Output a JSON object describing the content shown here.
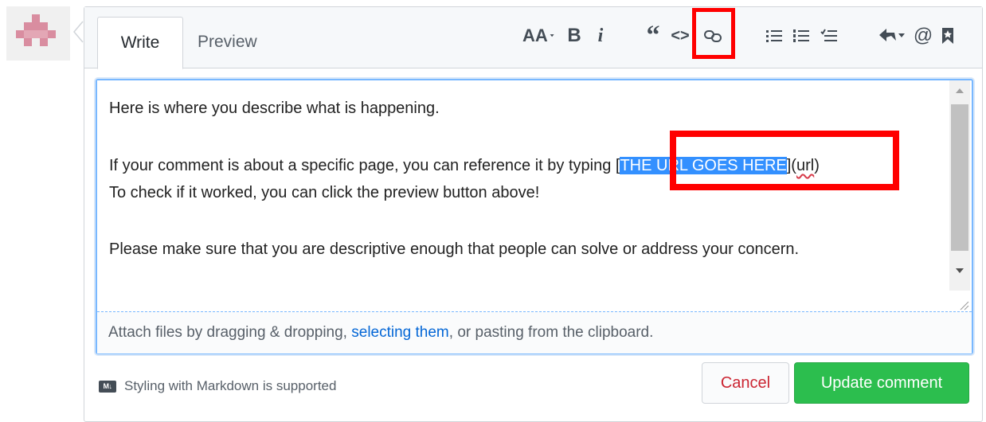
{
  "tabs": {
    "write": "Write",
    "preview": "Preview"
  },
  "toolbar": {
    "heading": "AA",
    "bold": "B",
    "italic": "i",
    "quote": "“",
    "code": "<>"
  },
  "editor": {
    "line1": "Here is where you describe what is happening.",
    "line2_before": "If your comment is about a specific page, you can reference it by typing [",
    "line2_selected": "THE URL GOES HERE",
    "line2_mid": "](",
    "line2_url": "url",
    "line2_after": ")",
    "line3": "To check if it worked, you can click the preview button above!",
    "line4": "Please make sure that you are descriptive enough that people can solve or address your concern."
  },
  "attach": {
    "prefix": "Attach files by dragging & dropping, ",
    "link": "selecting them",
    "suffix": ", or pasting from the clipboard."
  },
  "footer": {
    "markdown_badge": "M↓",
    "markdown_note": "Styling with Markdown is supported",
    "cancel": "Cancel",
    "update": "Update comment"
  },
  "colors": {
    "highlight": "#ff0000",
    "selection": "#3390ff",
    "primary": "#2cbe4e",
    "danger": "#cb2431",
    "link": "#0366d6"
  }
}
